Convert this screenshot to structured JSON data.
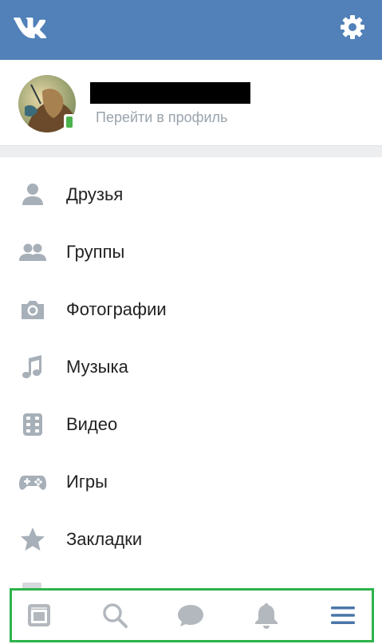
{
  "header": {
    "logo_icon": "vk-logo-icon",
    "settings_icon": "gear-icon",
    "background": "#5181b8"
  },
  "profile": {
    "avatar_icon": "avatar",
    "online_icon": "mobile-online-icon",
    "link_label": "Перейти в профиль"
  },
  "menu": {
    "items": [
      {
        "icon": "person-icon",
        "label": "Друзья"
      },
      {
        "icon": "people-icon",
        "label": "Группы"
      },
      {
        "icon": "camera-icon",
        "label": "Фотографии"
      },
      {
        "icon": "music-note-icon",
        "label": "Музыка"
      },
      {
        "icon": "film-icon",
        "label": "Видео"
      },
      {
        "icon": "gamepad-icon",
        "label": "Игры"
      },
      {
        "icon": "star-icon",
        "label": "Закладки"
      }
    ]
  },
  "tabbar": {
    "tabs": [
      {
        "icon": "news-feed-icon",
        "active": false
      },
      {
        "icon": "search-icon",
        "active": false
      },
      {
        "icon": "messages-icon",
        "active": false
      },
      {
        "icon": "bell-icon",
        "active": false
      },
      {
        "icon": "menu-icon",
        "active": true
      }
    ],
    "highlight_color": "#2db34a",
    "inactive_color": "#b3b8be",
    "active_color": "#4a76a8"
  }
}
